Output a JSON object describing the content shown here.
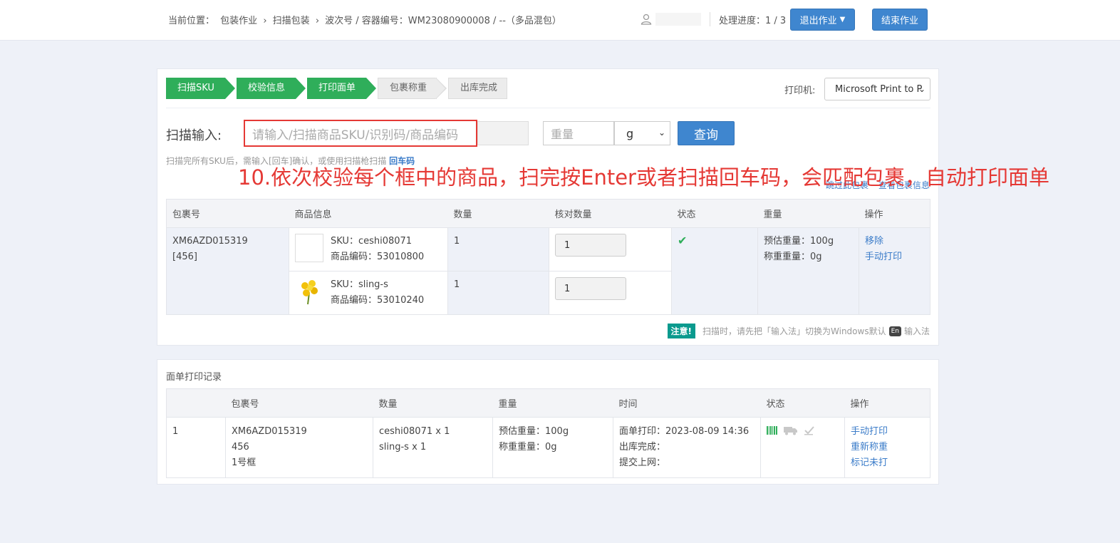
{
  "header": {
    "breadcrumb": [
      "当前位置：",
      "包装作业",
      "›",
      "扫描包装",
      "›",
      "波次号 / 容器编号：WM23080900008 / --（多品混包）"
    ],
    "progress_label": "处理进度：1 / 3",
    "exit_label": "退出作业",
    "end_label": "结束作业"
  },
  "steps": [
    {
      "label": "扫描SKU",
      "done": true
    },
    {
      "label": "校验信息",
      "done": true
    },
    {
      "label": "打印面单",
      "done": true
    },
    {
      "label": "包裹称重",
      "done": false
    },
    {
      "label": "出库完成",
      "done": false
    }
  ],
  "printer": {
    "label": "打印机:",
    "value": "Microsoft Print to P"
  },
  "scan": {
    "label": "扫描输入:",
    "placeholder": "请输入/扫描商品SKU/识别码/商品编码",
    "weight_placeholder": "重量",
    "unit": "g",
    "query_label": "查询",
    "hint": "扫描完所有SKU后，需输入[回车]确认，或使用扫描枪扫描",
    "hint_link": "回车码",
    "link_skip": "跳过此包裹",
    "link_view": "查看包裹信息"
  },
  "annotation": "10.依次校验每个框中的商品，扫完按Enter或者扫描回车码，会匹配包裹，自动打印面单",
  "package_table": {
    "headers": [
      "包裹号",
      "商品信息",
      "数量",
      "核对数量",
      "状态",
      "重量",
      "操作"
    ],
    "package_no": "XM6AZD015319",
    "package_sub": "[456]",
    "items": [
      {
        "sku": "SKU：ceshi08071",
        "code": "商品编码：53010800",
        "qty": "1",
        "check_qty": "1"
      },
      {
        "sku": "SKU：sling-s",
        "code": "商品编码：53010240",
        "qty": "1",
        "check_qty": "1"
      }
    ],
    "est_weight": "预估重量：100g",
    "actual_weight": "称重重量：0g",
    "action_remove": "移除",
    "action_print": "手动打印"
  },
  "notice": {
    "tag": "注意!",
    "text": "扫描时，请先把「输入法」切换为Windows默认",
    "en": "En",
    "suffix": "输入法"
  },
  "print_records": {
    "title": "面单打印记录",
    "headers": [
      "",
      "包裹号",
      "数量",
      "重量",
      "时间",
      "状态",
      "操作"
    ],
    "row": {
      "index": "1",
      "pkg": [
        "XM6AZD015319",
        "456",
        "1号框"
      ],
      "qty": [
        "ceshi08071 x 1",
        "sling-s x 1"
      ],
      "weight": [
        "预估重量：100g",
        "称重重量：0g"
      ],
      "time": [
        "面单打印：2023-08-09 14:36",
        "出库完成：",
        "提交上网："
      ],
      "actions": [
        "手动打印",
        "重新称重",
        "标记未打"
      ]
    }
  },
  "colors": {
    "primary": "#3f86cf",
    "success": "#2fae5a",
    "annotation": "#e53935",
    "notice": "#0a9a8e"
  }
}
